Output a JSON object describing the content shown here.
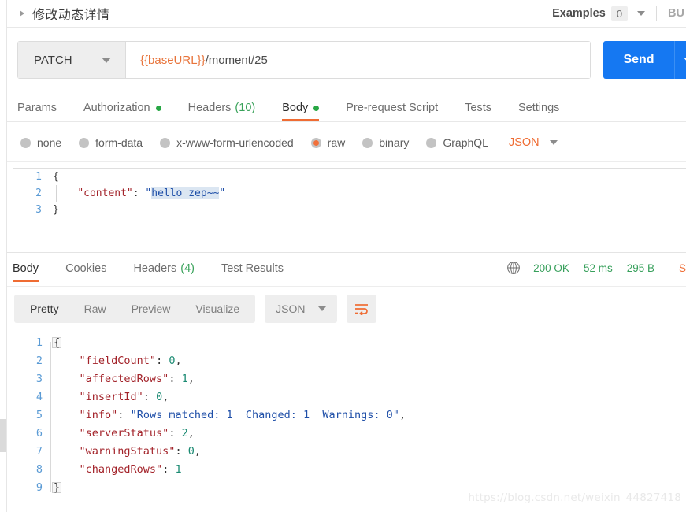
{
  "titlebar": {
    "request_name": "修改动态详情",
    "examples_label": "Examples",
    "examples_count": "0",
    "build_label": "BU"
  },
  "request": {
    "method": "PATCH",
    "url_variable": "{{baseURL}}",
    "url_path": "/moment/25",
    "send_label": "Send"
  },
  "request_tabs": [
    {
      "label": "Params",
      "dot": false,
      "count": "",
      "active": false
    },
    {
      "label": "Authorization",
      "dot": true,
      "count": "",
      "active": false
    },
    {
      "label": "Headers",
      "dot": false,
      "count": "(10)",
      "active": false
    },
    {
      "label": "Body",
      "dot": true,
      "count": "",
      "active": true
    },
    {
      "label": "Pre-request Script",
      "dot": false,
      "count": "",
      "active": false
    },
    {
      "label": "Tests",
      "dot": false,
      "count": "",
      "active": false
    },
    {
      "label": "Settings",
      "dot": false,
      "count": "",
      "active": false
    }
  ],
  "body_types": [
    {
      "label": "none",
      "selected": false
    },
    {
      "label": "form-data",
      "selected": false
    },
    {
      "label": "x-www-form-urlencoded",
      "selected": false
    },
    {
      "label": "raw",
      "selected": true
    },
    {
      "label": "binary",
      "selected": false
    },
    {
      "label": "GraphQL",
      "selected": false
    }
  ],
  "body_format": "JSON",
  "request_body": {
    "line1_num": "1",
    "line1_text": "{",
    "line2_num": "2",
    "line2_key": "\"content\"",
    "line2_colon": ": ",
    "line2_quote_open": "\"",
    "line2_value": "hello zep~~",
    "line2_quote_close": "\"",
    "line3_num": "3",
    "line3_text": "}"
  },
  "response_tabs": [
    {
      "label": "Body",
      "count": "",
      "active": true
    },
    {
      "label": "Cookies",
      "count": "",
      "active": false
    },
    {
      "label": "Headers",
      "count": "(4)",
      "active": false
    },
    {
      "label": "Test Results",
      "count": "",
      "active": false
    }
  ],
  "response_status": {
    "status": "200 OK",
    "time": "52 ms",
    "size": "295 B",
    "save_label": "S"
  },
  "response_toolbar": {
    "segments": [
      {
        "label": "Pretty",
        "active": true
      },
      {
        "label": "Raw",
        "active": false
      },
      {
        "label": "Preview",
        "active": false
      },
      {
        "label": "Visualize",
        "active": false
      }
    ],
    "format": "JSON"
  },
  "response_body": {
    "lines": [
      {
        "num": "1",
        "type": "brace",
        "text": "{"
      },
      {
        "num": "2",
        "type": "pair",
        "key": "\"fieldCount\"",
        "value": "0",
        "value_type": "num",
        "comma": ","
      },
      {
        "num": "3",
        "type": "pair",
        "key": "\"affectedRows\"",
        "value": "1",
        "value_type": "num",
        "comma": ","
      },
      {
        "num": "4",
        "type": "pair",
        "key": "\"insertId\"",
        "value": "0",
        "value_type": "num",
        "comma": ","
      },
      {
        "num": "5",
        "type": "pair",
        "key": "\"info\"",
        "value": "\"Rows matched: 1  Changed: 1  Warnings: 0\"",
        "value_type": "str",
        "comma": ","
      },
      {
        "num": "6",
        "type": "pair",
        "key": "\"serverStatus\"",
        "value": "2",
        "value_type": "num",
        "comma": ","
      },
      {
        "num": "7",
        "type": "pair",
        "key": "\"warningStatus\"",
        "value": "0",
        "value_type": "num",
        "comma": ","
      },
      {
        "num": "8",
        "type": "pair",
        "key": "\"changedRows\"",
        "value": "1",
        "value_type": "num",
        "comma": ""
      },
      {
        "num": "9",
        "type": "brace",
        "text": "}"
      }
    ]
  },
  "watermark": "https://blog.csdn.net/weixin_44827418",
  "colors": {
    "accent_orange": "#ef6c33",
    "send_blue": "#1578f2",
    "status_green": "#38a05c",
    "dot_green": "#28a745",
    "json_key": "#a3232a",
    "json_string": "#1f4fa8",
    "json_number": "#1a8a72",
    "line_number": "#5b9bd5",
    "selection": "#dbe6f2"
  }
}
